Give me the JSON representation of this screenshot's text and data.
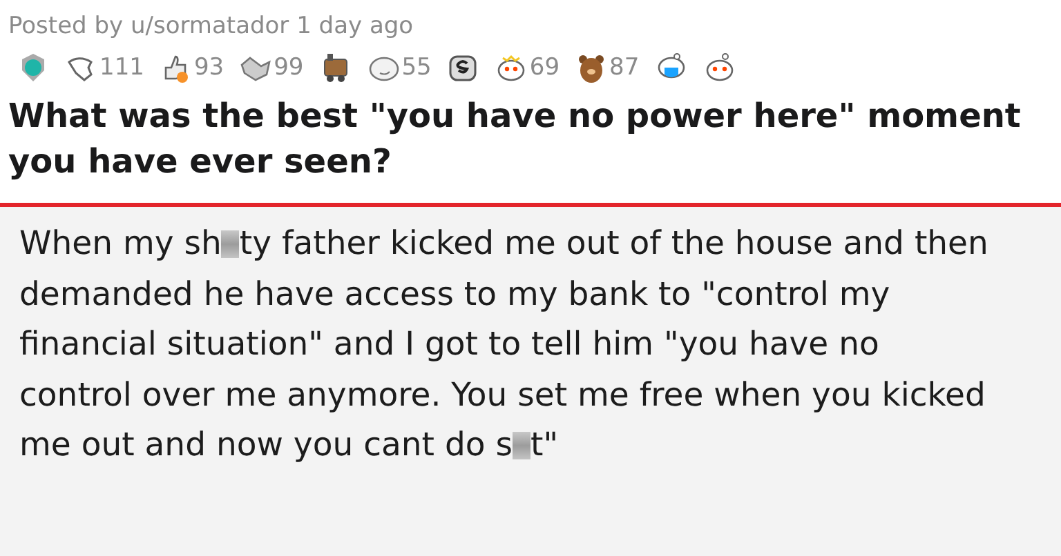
{
  "post": {
    "byline": "Posted by u/sormatador 1 day ago",
    "awards": [
      {
        "kind": "icon"
      },
      {
        "kind": "counted",
        "count": "111"
      },
      {
        "kind": "counted",
        "count": "93"
      },
      {
        "kind": "counted",
        "count": "99"
      },
      {
        "kind": "icon"
      },
      {
        "kind": "counted",
        "count": "55"
      },
      {
        "kind": "icon"
      },
      {
        "kind": "counted",
        "count": "69"
      },
      {
        "kind": "counted",
        "count": "87"
      },
      {
        "kind": "icon"
      },
      {
        "kind": "icon"
      }
    ],
    "title": "What was the best \"you have no power here\" moment you have ever seen?"
  },
  "comment": {
    "parts": [
      {
        "kind": "text",
        "text": "When my sh"
      },
      {
        "kind": "censor"
      },
      {
        "kind": "text",
        "text": "ty father kicked me out of the house and then demanded he have access to my bank to \"control my financial situation\" and I got to tell him \"you have no control over me anymore. You set me free when you kicked me out and now you cant do s"
      },
      {
        "kind": "censor"
      },
      {
        "kind": "text",
        "text": "t\""
      }
    ]
  }
}
